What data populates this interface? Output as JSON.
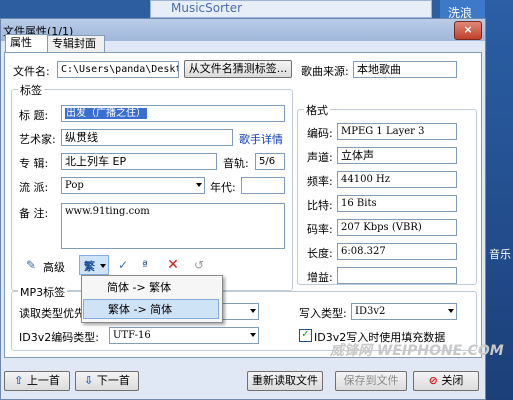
{
  "background": {
    "strip_text": "MusicSorter",
    "right_tab": "洗浪",
    "right_labels": [
      "音乐"
    ]
  },
  "dialog": {
    "title": "文件属性(1/1)",
    "close": "×"
  },
  "tabs": [
    {
      "label": "属性"
    },
    {
      "label": "专辑封面"
    }
  ],
  "file": {
    "label": "文件名:",
    "value": "C:\\Users\\panda\\Desktop",
    "guess_button": "从文件名猜测标签...",
    "source_label": "歌曲来源:",
    "source_value": "本地歌曲"
  },
  "tag_group": {
    "title": "标签",
    "title_label": "标  题:",
    "title_value": "出发（广播之住）",
    "artist_label": "艺术家:",
    "artist_value": "纵贯线",
    "artist_link": "歌手详情",
    "album_label": "专  辑:",
    "album_value": "北上列车 EP",
    "track_label": "音轨:",
    "track_value": "5/6",
    "genre_label": "流  派:",
    "genre_value": "Pop",
    "year_label": "年代:",
    "year_value": "",
    "comment_label": "备  注:",
    "comment_value": "www.91ting.com"
  },
  "toolbar": {
    "advanced_label": "高级",
    "convert_label": "繁"
  },
  "menu": {
    "items": [
      "简体 -> 繁体",
      "繁体 -> 简体"
    ]
  },
  "format_group": {
    "title": "格式",
    "encoding_label": "编码:",
    "encoding_value": "MPEG 1 Layer 3",
    "channel_label": "声道:",
    "channel_value": "立体声",
    "freq_label": "频率:",
    "freq_value": "44100 Hz",
    "bits_label": "比特:",
    "bits_value": "16 Bits",
    "bitrate_label": "码率:",
    "bitrate_value": "207 Kbps (VBR)",
    "length_label": "长度:",
    "length_value": "6:08.327",
    "gain_label": "增益:",
    "gain_value": ""
  },
  "mp3": {
    "title": "MP3标签",
    "read_label": "读取类型优先:",
    "read_value": "",
    "id3_encoding_label": "ID3v2编码类型:",
    "id3_encoding_value": "UTF-16",
    "write_label": "写入类型:",
    "write_value": "ID3v2",
    "pad_checkbox_label": "ID3v2写入时使用填充数据",
    "pad_checked": true
  },
  "footer": {
    "prev": "上一首",
    "next": "下一首",
    "reload": "重新读取文件",
    "save": "保存到文件",
    "close": "关闭"
  },
  "watermark": "威锋网 WEIPHONE.COM"
}
